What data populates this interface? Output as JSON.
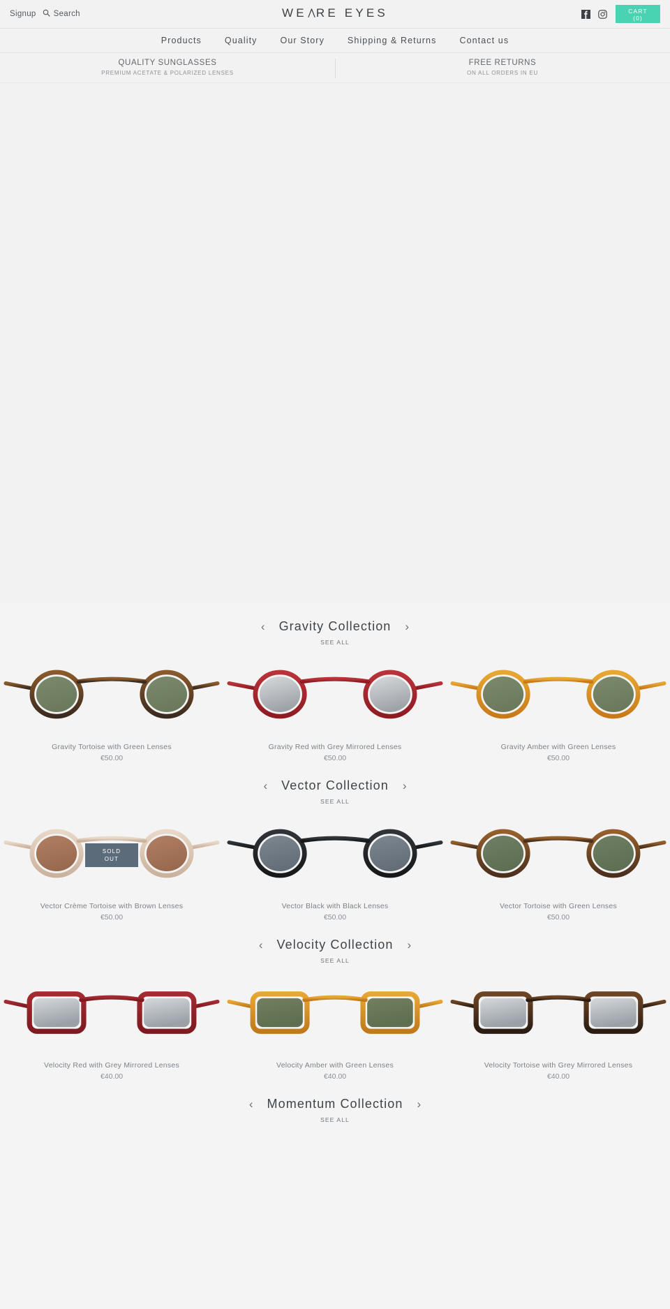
{
  "topbar": {
    "signup_label": "Signup",
    "search_label": "Search",
    "search_icon": "search-icon",
    "logo_text_1": "WE",
    "logo_text_2": "RE EYES",
    "facebook_icon": "facebook-icon",
    "instagram_icon": "instagram-icon",
    "cart_label": "CART",
    "cart_count": "(0)",
    "cart_color": "#4ad3b2"
  },
  "nav": {
    "items": [
      {
        "label": "Products"
      },
      {
        "label": "Quality"
      },
      {
        "label": "Our Story"
      },
      {
        "label": "Shipping & Returns"
      },
      {
        "label": "Contact us"
      }
    ]
  },
  "promo": {
    "columns": [
      {
        "title": "QUALITY SUNGLASSES",
        "subtitle": "PREMIUM ACETATE & POLARIZED LENSES"
      },
      {
        "title": "FREE RETURNS",
        "subtitle": "ON ALL ORDERS IN EU"
      }
    ]
  },
  "collections": [
    {
      "title": "Gravity Collection",
      "see_all": "SEE ALL",
      "prev": "‹",
      "next": "›",
      "products": [
        {
          "name": "Gravity Tortoise with Green Lenses",
          "price": "€50.00",
          "frame": "#3a2a1e",
          "frame2": "#8a5a2c",
          "lens": "#7b8a6d",
          "lens2": "#6b7a5d",
          "shape": "round",
          "tortoise": true,
          "sold_out": false
        },
        {
          "name": "Gravity Red with Grey Mirrored Lenses",
          "price": "€50.00",
          "frame": "#8e1b22",
          "frame2": "#b9333a",
          "lens": "#d8dadc",
          "lens2": "#9ea3a8",
          "shape": "round",
          "tortoise": false,
          "sold_out": false
        },
        {
          "name": "Gravity Amber with Green Lenses",
          "price": "€50.00",
          "frame": "#c87a18",
          "frame2": "#e8a733",
          "lens": "#7b8a6d",
          "lens2": "#6b7a5d",
          "shape": "round",
          "tortoise": true,
          "sold_out": false
        }
      ]
    },
    {
      "title": "Vector Collection",
      "see_all": "SEE ALL",
      "prev": "‹",
      "next": "›",
      "products": [
        {
          "name": "Vector Crème Tortoise with Brown Lenses",
          "price": "€50.00",
          "frame": "#cbb29c",
          "frame2": "#e8d8c8",
          "lens": "#b07f63",
          "lens2": "#9a6a50",
          "shape": "round",
          "tortoise": true,
          "sold_out": true,
          "sold_out_line1": "SOLD",
          "sold_out_line2": "OUT"
        },
        {
          "name": "Vector Black with Black Lenses",
          "price": "€50.00",
          "frame": "#16181a",
          "frame2": "#303438",
          "lens": "#7d8790",
          "lens2": "#646e78",
          "shape": "round",
          "tortoise": false,
          "sold_out": false
        },
        {
          "name": "Vector Tortoise with Green Lenses",
          "price": "€50.00",
          "frame": "#4a2f1c",
          "frame2": "#96602c",
          "lens": "#6f7f62",
          "lens2": "#5f6f54",
          "shape": "round",
          "tortoise": true,
          "sold_out": false
        }
      ]
    },
    {
      "title": "Velocity Collection",
      "see_all": "SEE ALL",
      "prev": "‹",
      "next": "›",
      "products": [
        {
          "name": "Velocity Red with Grey Mirrored Lenses",
          "price": "€40.00",
          "frame": "#7d1a20",
          "frame2": "#a52a32",
          "lens": "#d5d8db",
          "lens2": "#9aa0a6",
          "shape": "wayfarer",
          "tortoise": false,
          "sold_out": false
        },
        {
          "name": "Velocity Amber with Green Lenses",
          "price": "€40.00",
          "frame": "#c07a1c",
          "frame2": "#e8a733",
          "lens": "#70805f",
          "lens2": "#5e6e50",
          "shape": "wayfarer",
          "tortoise": true,
          "sold_out": false
        },
        {
          "name": "Velocity Tortoise with Grey Mirrored Lenses",
          "price": "€40.00",
          "frame": "#2a1c12",
          "frame2": "#6e4524",
          "lens": "#d5d8db",
          "lens2": "#9aa0a6",
          "shape": "wayfarer",
          "tortoise": true,
          "sold_out": false
        }
      ]
    },
    {
      "title": "Momentum Collection",
      "see_all": "SEE ALL",
      "prev": "‹",
      "next": "›",
      "products": []
    }
  ]
}
